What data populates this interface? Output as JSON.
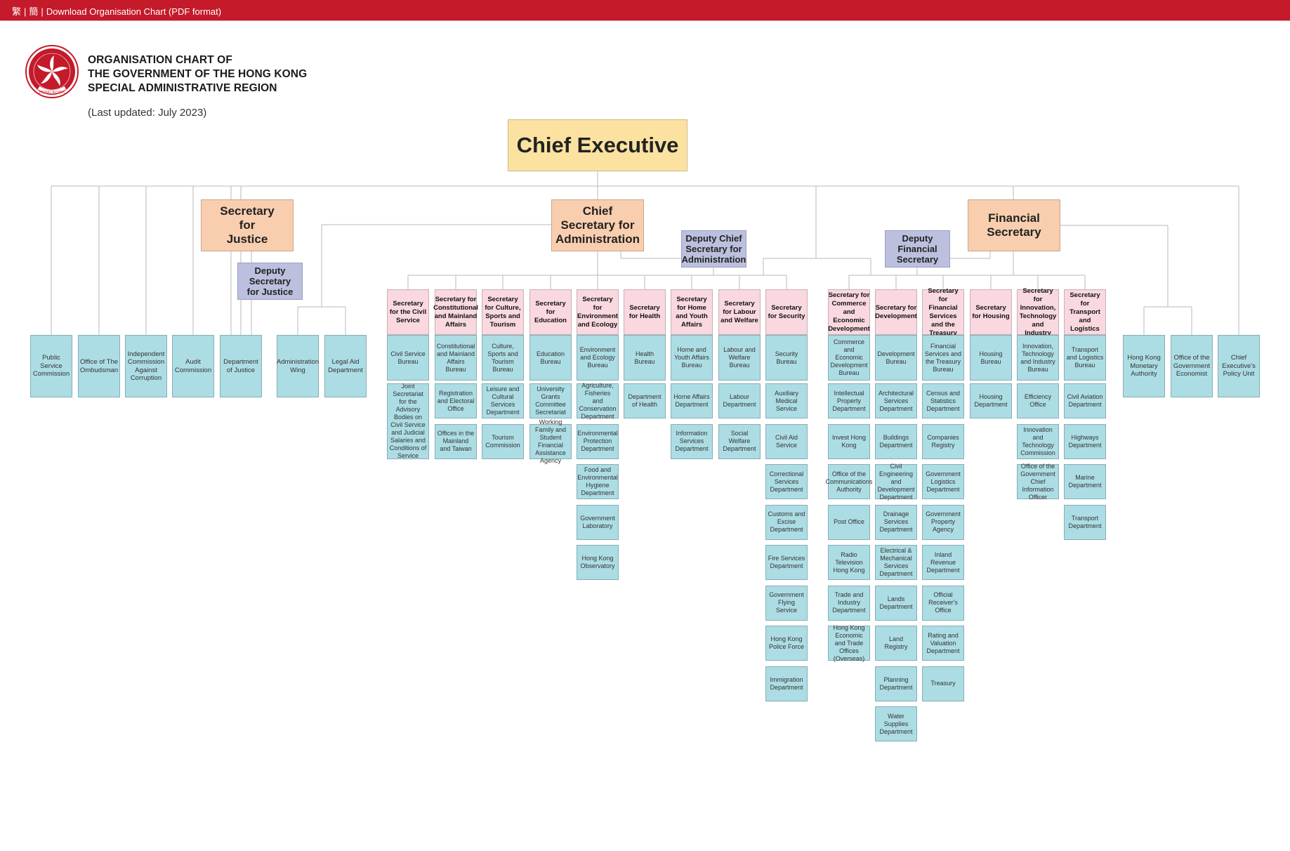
{
  "topbar": {
    "traditional_chinese": "繁",
    "simplified_chinese": "簡",
    "separator": "|",
    "download_link": "Download Organisation Chart (PDF format)",
    "color": "#c41a2a"
  },
  "header": {
    "emblem": "hong-kong-emblem-icon",
    "emblem_text": "HONG KONG",
    "title_line1": "ORGANISATION CHART OF",
    "title_line2": "THE GOVERNMENT OF THE HONG KONG",
    "title_line3": "SPECIAL ADMINISTRATIVE REGION",
    "last_updated": "(Last updated: July 2023)"
  },
  "colors": {
    "chief_executive": "#fbe2a0",
    "secretary": "#f8ceae",
    "deputy": "#bcc0de",
    "policy_bureau_head": "#f9d8df",
    "department": "#addde4",
    "connector": "#b8b8b8"
  },
  "chief_executive": "Chief Executive",
  "secretary_for_justice": {
    "title": "Secretary for Justice",
    "deputy": "Deputy Secretary for Justice"
  },
  "chief_secretary": {
    "title": "Chief Secretary for Administration",
    "deputy": "Deputy Chief Secretary for Administration",
    "direct_units": [
      "Administration Wing",
      "Legal Aid Department"
    ]
  },
  "financial_secretary": {
    "title": "Financial Secretary",
    "deputy": "Deputy Financial Secretary",
    "direct_units": [
      "Hong Kong Monetary Authority",
      "Office of the Government Economist"
    ]
  },
  "independent_left": [
    "Public Service Commission",
    "Office of The Ombudsman",
    "Independent Commission Against Corruption",
    "Audit Commission",
    "Department of Justice"
  ],
  "independent_right": [
    "Chief Executive's Policy Unit"
  ],
  "cs_bureaux": [
    {
      "secretary": "Secretary for the Civil Service",
      "bureau": "Civil Service Bureau",
      "departments": [
        "Joint Secretariat for the Advisory Bodies on Civil Service and Judicial Salaries and Conditions of Service"
      ]
    },
    {
      "secretary": "Secretary for Constitutional and Mainland Affairs",
      "bureau": "Constitutional and Mainland Affairs Bureau",
      "departments": [
        "Registration and Electoral Office",
        "Offices in the Mainland and Taiwan"
      ]
    },
    {
      "secretary": "Secretary for Culture, Sports and Tourism",
      "bureau": "Culture, Sports and Tourism Bureau",
      "departments": [
        "Leisure and Cultural Services Department",
        "Tourism Commission"
      ]
    },
    {
      "secretary": "Secretary for Education",
      "bureau": "Education Bureau",
      "departments": [
        "University Grants Committee Secretariat",
        "Working Family and Student Financial Assistance Agency"
      ]
    },
    {
      "secretary": "Secretary for Environment and Ecology",
      "bureau": "Environment and Ecology Bureau",
      "departments": [
        "Agriculture, Fisheries and Conservation Department",
        "Environmental Protection Department",
        "Food and Environmental Hygiene Department",
        "Government Laboratory",
        "Hong Kong Observatory"
      ]
    },
    {
      "secretary": "Secretary for Health",
      "bureau": "Health Bureau",
      "departments": [
        "Department of Health"
      ]
    },
    {
      "secretary": "Secretary for Home and Youth Affairs",
      "bureau": "Home and Youth Affairs Bureau",
      "departments": [
        "Home Affairs Department",
        "Information Services Department"
      ]
    },
    {
      "secretary": "Secretary for Labour and Welfare",
      "bureau": "Labour and Welfare Bureau",
      "departments": [
        "Labour Department",
        "Social Welfare Department"
      ]
    },
    {
      "secretary": "Secretary for Security",
      "bureau": "Security Bureau",
      "departments": [
        "Auxiliary Medical Service",
        "Civil Aid Service",
        "Correctional Services Department",
        "Customs and Excise Department",
        "Fire Services Department",
        "Government Flying Service",
        "Hong Kong Police Force",
        "Immigration Department"
      ]
    }
  ],
  "fs_bureaux": [
    {
      "secretary": "Secretary for Commerce and Economic Development",
      "bureau": "Commerce and Economic Development Bureau",
      "departments": [
        "Intellectual Property Department",
        "Invest Hong Kong",
        "Office of the Communications Authority",
        "Post Office",
        "Radio Television Hong Kong",
        "Trade and Industry Department",
        "Hong Kong Economic and Trade Offices (Overseas)"
      ]
    },
    {
      "secretary": "Secretary for Development",
      "bureau": "Development Bureau",
      "departments": [
        "Architectural Services Department",
        "Buildings Department",
        "Civil Engineering and Development Department",
        "Drainage Services Department",
        "Electrical & Mechanical Services Department",
        "Lands Department",
        "Land Registry",
        "Planning Department",
        "Water Supplies Department"
      ]
    },
    {
      "secretary": "Secretary for Financial Services and the Treasury",
      "bureau": "Financial Services and the Treasury Bureau",
      "departments": [
        "Census and Statistics Department",
        "Companies Registry",
        "Government Logistics Department",
        "Government Property Agency",
        "Inland Revenue Department",
        "Official Receiver's Office",
        "Rating and Valuation Department",
        "Treasury"
      ]
    },
    {
      "secretary": "Secretary for Housing",
      "bureau": "Housing Bureau",
      "departments": [
        "Housing Department"
      ]
    },
    {
      "secretary": "Secretary for Innovation, Technology and Industry",
      "bureau": "Innovation, Technology and Industry Bureau",
      "departments": [
        "Efficiency Office",
        "Innovation and Technology Commission",
        "Office of the Government Chief Information Officer"
      ]
    },
    {
      "secretary": "Secretary for Transport and Logistics",
      "bureau": "Transport and Logistics Bureau",
      "departments": [
        "Civil Aviation Department",
        "Highways Department",
        "Marine Department",
        "Transport Department"
      ]
    }
  ]
}
